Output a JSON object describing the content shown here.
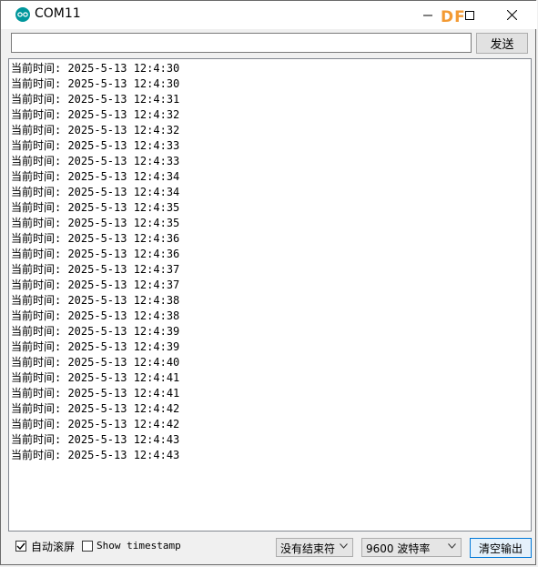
{
  "window": {
    "title": "COM11",
    "watermark": "DF"
  },
  "send": {
    "input_value": "",
    "button_label": "发送"
  },
  "output_lines": [
    "当前时间: 2025-5-13 12:4:30",
    "当前时间: 2025-5-13 12:4:30",
    "当前时间: 2025-5-13 12:4:31",
    "当前时间: 2025-5-13 12:4:32",
    "当前时间: 2025-5-13 12:4:32",
    "当前时间: 2025-5-13 12:4:33",
    "当前时间: 2025-5-13 12:4:33",
    "当前时间: 2025-5-13 12:4:34",
    "当前时间: 2025-5-13 12:4:34",
    "当前时间: 2025-5-13 12:4:35",
    "当前时间: 2025-5-13 12:4:35",
    "当前时间: 2025-5-13 12:4:36",
    "当前时间: 2025-5-13 12:4:36",
    "当前时间: 2025-5-13 12:4:37",
    "当前时间: 2025-5-13 12:4:37",
    "当前时间: 2025-5-13 12:4:38",
    "当前时间: 2025-5-13 12:4:38",
    "当前时间: 2025-5-13 12:4:39",
    "当前时间: 2025-5-13 12:4:39",
    "当前时间: 2025-5-13 12:4:40",
    "当前时间: 2025-5-13 12:4:41",
    "当前时间: 2025-5-13 12:4:41",
    "当前时间: 2025-5-13 12:4:42",
    "当前时间: 2025-5-13 12:4:42",
    "当前时间: 2025-5-13 12:4:43",
    "当前时间: 2025-5-13 12:4:43"
  ],
  "bottom": {
    "autoscroll_label": "自动滚屏",
    "autoscroll_checked": true,
    "timestamp_label": "Show timestamp",
    "timestamp_checked": false,
    "line_ending": "没有结束符",
    "baud_rate": "9600 波特率",
    "clear_label": "清空输出"
  },
  "icons": {
    "app": "arduino-logo-icon",
    "minimize": "minimize-icon",
    "maximize": "maximize-icon",
    "close": "close-icon",
    "dropdown": "chevron-down-icon",
    "check": "checkmark-icon"
  },
  "colors": {
    "app_icon": "#00979c",
    "watermark": "#f39a33",
    "focus_border": "#0078d7"
  }
}
